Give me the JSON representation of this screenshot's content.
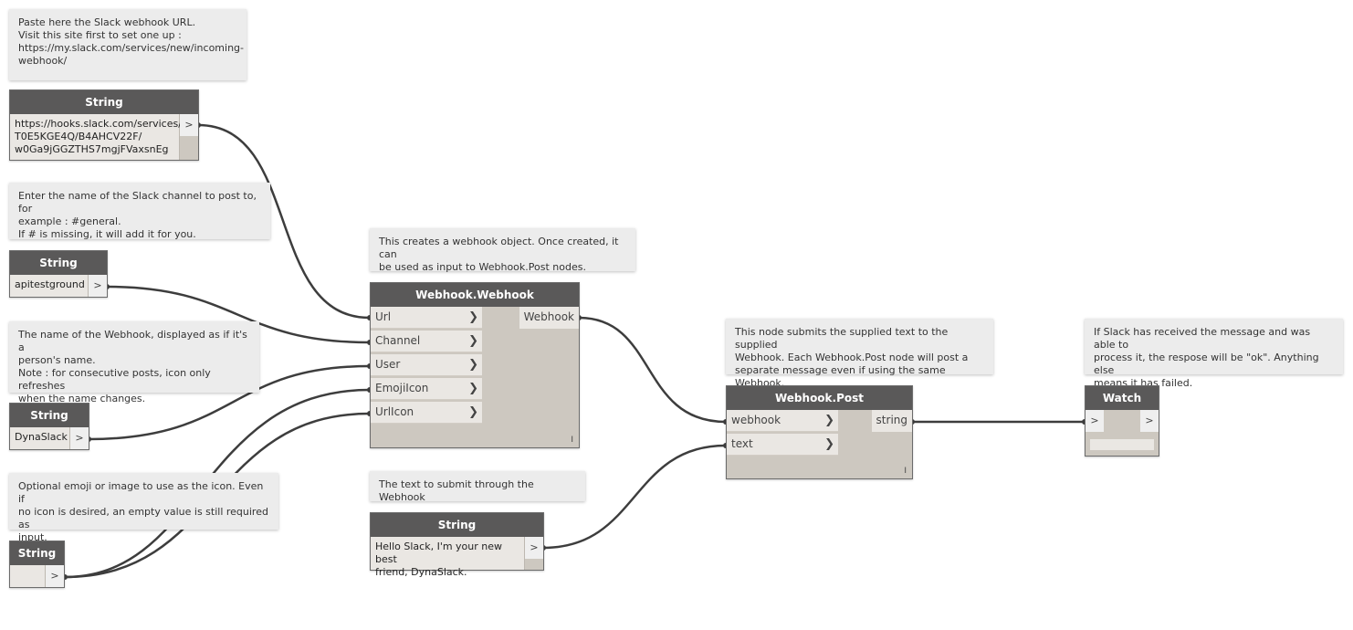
{
  "notes": {
    "url_note": "Paste here the Slack webhook URL.\nVisit this site first to set one up :\nhttps://my.slack.com/services/new/incoming-\nwebhook/",
    "channel_note": "Enter the name of the Slack channel to post to, for\nexample : #general.\nIf # is missing, it will add it for you.",
    "name_note": "The name of the Webhook, displayed as if it's a\nperson's name.\nNote : for consecutive posts, icon only refreshes\nwhen the name changes.",
    "icon_note": "Optional emoji or image to use as the icon. Even if\nno icon is desired, an empty value is still required as\ninput.",
    "webhook_note": "This creates a webhook object. Once created, it can\nbe used as input to Webhook.Post nodes.",
    "text_note": "The text to submit through the Webhook",
    "post_note": "This node submits the supplied text to the supplied\nWebhook. Each Webhook.Post node will post a\nseparate message even if using the same Webhook.",
    "watch_note": "If Slack has received the message and was able to\nprocess it, the respose will be \"ok\". Anything else\nmeans it has failed."
  },
  "string_nodes": {
    "url": {
      "title": "String",
      "value": "https://hooks.slack.com/services/\nT0E5KGE4Q/B4AHCV22F/\nw0Ga9jGGZTHS7mgjFVaxsnEg",
      "port": ">"
    },
    "channel": {
      "title": "String",
      "value": "apitestground",
      "port": ">"
    },
    "name": {
      "title": "String",
      "value": "DynaSlack",
      "port": ">"
    },
    "icon": {
      "title": "String",
      "value": "",
      "port": ">"
    },
    "text": {
      "title": "String",
      "value": "Hello Slack, I'm your new best\nfriend, DynaSlack.",
      "port": ">"
    }
  },
  "webhook_node": {
    "title": "Webhook.Webhook",
    "inputs": [
      "Url",
      "Channel",
      "User",
      "EmojiIcon",
      "UrlIcon"
    ],
    "output": "Webhook",
    "lacing": "I"
  },
  "post_node": {
    "title": "Webhook.Post",
    "inputs": [
      "webhook",
      "text"
    ],
    "output": "string",
    "lacing": "I"
  },
  "watch_node": {
    "title": "Watch",
    "in_port": ">",
    "out_port": ">"
  },
  "colors": {
    "canvas": "#ffffff",
    "node_title": "#5a5959",
    "node_body": "#cdc8c0",
    "port": "#eae7e3",
    "note": "#ececec",
    "wire": "#3d3d3d"
  }
}
